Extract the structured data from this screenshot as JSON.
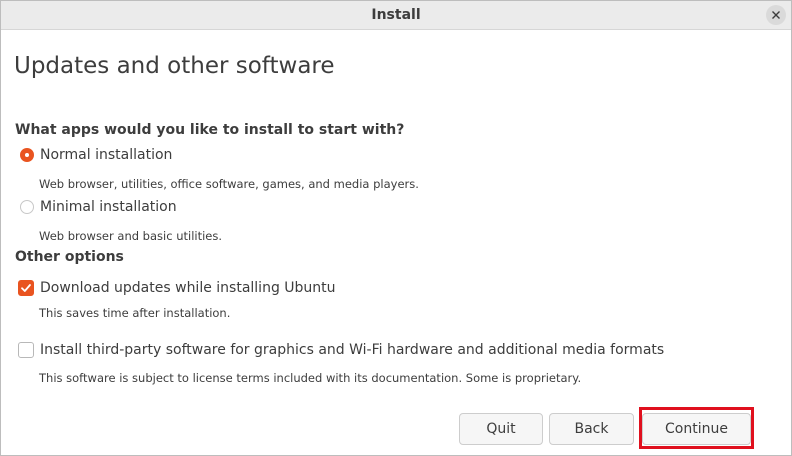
{
  "window": {
    "title": "Install"
  },
  "page": {
    "title": "Updates and other software",
    "question": "What apps would you like to install to start with?"
  },
  "install_type": {
    "options": [
      {
        "label": "Normal installation",
        "description": "Web browser, utilities, office software, games, and media players.",
        "selected": true
      },
      {
        "label": "Minimal installation",
        "description": "Web browser and basic utilities.",
        "selected": false
      }
    ]
  },
  "other_options": {
    "heading": "Other options",
    "items": [
      {
        "label": "Download updates while installing Ubuntu",
        "description": "This saves time after installation.",
        "checked": true
      },
      {
        "label": "Install third-party software for graphics and Wi-Fi hardware and additional media formats",
        "description": "This software is subject to license terms included with its documentation. Some is proprietary.",
        "checked": false
      }
    ]
  },
  "buttons": {
    "quit": "Quit",
    "back": "Back",
    "continue": "Continue"
  },
  "colors": {
    "accent": "#e95420",
    "highlight_box": "#e0101e"
  },
  "icons": {
    "close": "close-icon",
    "check": "checkmark-icon"
  }
}
